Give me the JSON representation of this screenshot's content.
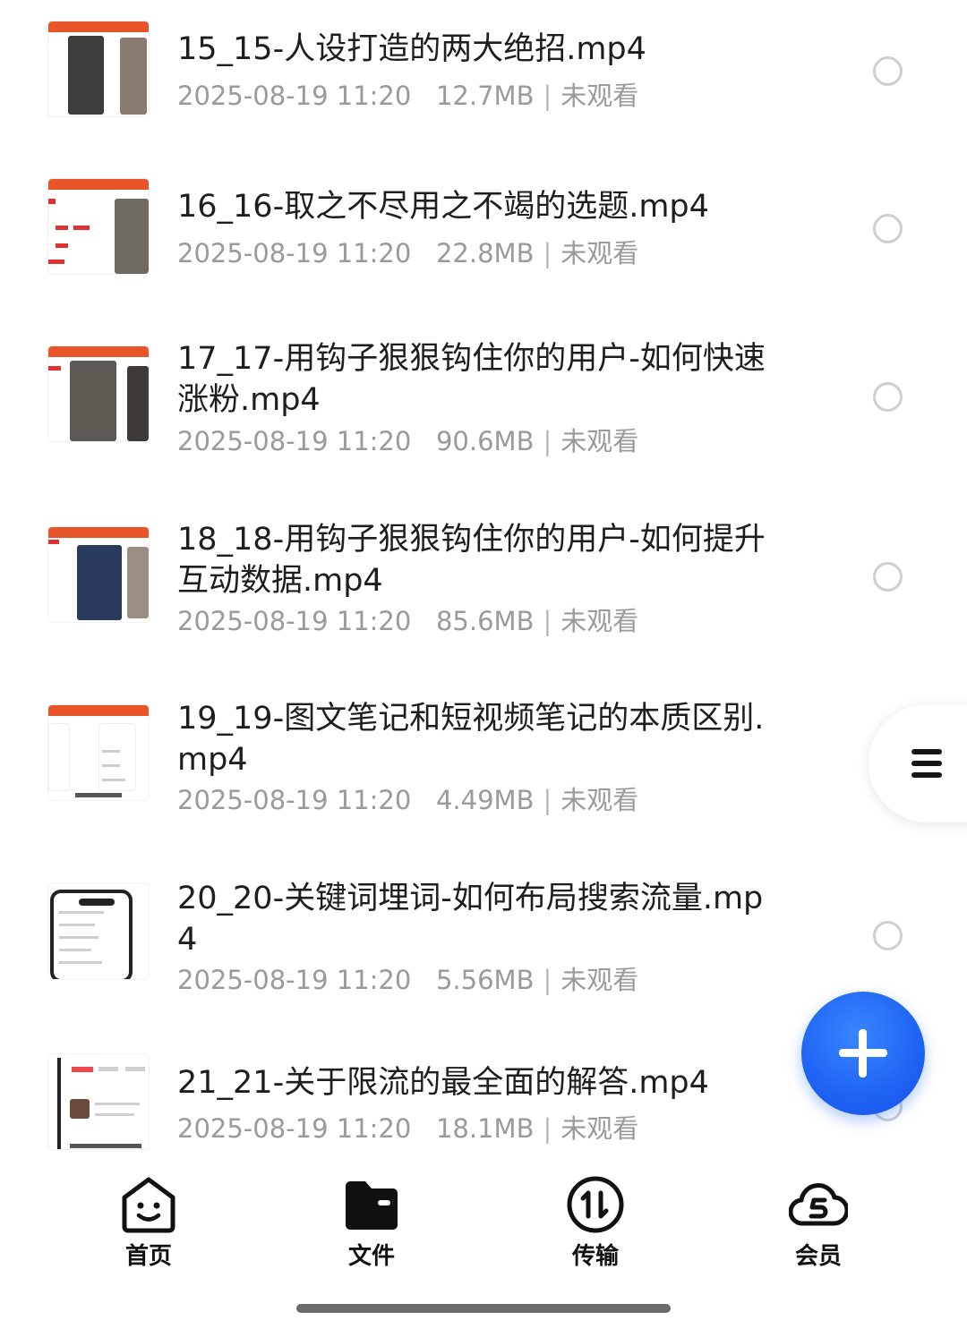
{
  "files": [
    {
      "title": "15_15-人设打造的两大绝招.mp4",
      "date": "2025-08-19 11:20",
      "size": "12.7MB",
      "status": "未观看"
    },
    {
      "title": "16_16-取之不尽用之不竭的选题.mp4",
      "date": "2025-08-19 11:20",
      "size": "22.8MB",
      "status": "未观看"
    },
    {
      "title": "17_17-用钩子狠狠钩住你的用户-如何快速涨粉.mp4",
      "date": "2025-08-19 11:20",
      "size": "90.6MB",
      "status": "未观看"
    },
    {
      "title": "18_18-用钩子狠狠钩住你的用户-如何提升互动数据.mp4",
      "date": "2025-08-19 11:20",
      "size": "85.6MB",
      "status": "未观看"
    },
    {
      "title": "19_19-图文笔记和短视频笔记的本质区别.mp4",
      "date": "2025-08-19 11:20",
      "size": "4.49MB",
      "status": "未观看"
    },
    {
      "title": "20_20-关键词埋词-如何布局搜索流量.mp4",
      "date": "2025-08-19 11:20",
      "size": "5.56MB",
      "status": "未观看"
    },
    {
      "title": "21_21-关于限流的最全面的解答.mp4",
      "date": "2025-08-19 11:20",
      "size": "18.1MB",
      "status": "未观看"
    }
  ],
  "meta_separator": "|",
  "side_menu": {
    "icon": "hamburger-menu-icon"
  },
  "fab": {
    "icon": "plus-icon",
    "color": "#1e63f3"
  },
  "nav": [
    {
      "label": "首页",
      "icon": "home-face-icon"
    },
    {
      "label": "文件",
      "icon": "folder-icon",
      "active": true
    },
    {
      "label": "传输",
      "icon": "transfer-icon"
    },
    {
      "label": "会员",
      "icon": "membership-cloud-icon"
    }
  ]
}
